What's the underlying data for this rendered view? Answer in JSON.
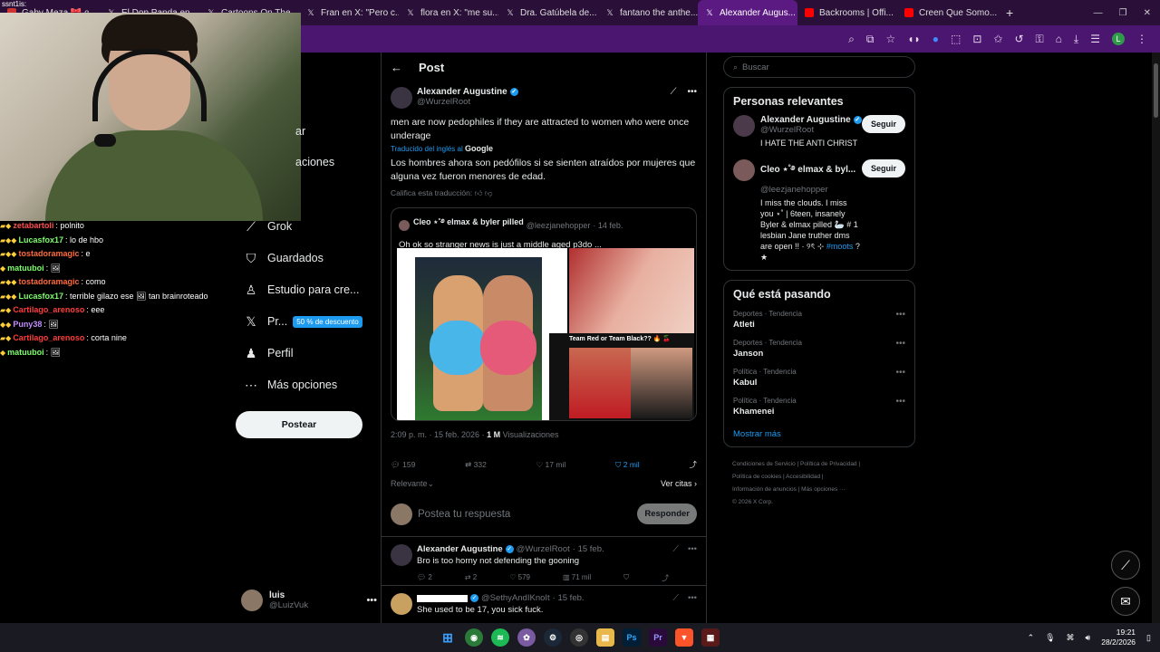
{
  "browser": {
    "tabs": [
      {
        "label": "Gaby Meza 🎀 ɞ..."
      },
      {
        "label": "El Don Panda en..."
      },
      {
        "label": "Cartoons On The..."
      },
      {
        "label": "Fran en X: \"Pero c..."
      },
      {
        "label": "flora en X: \"me su..."
      },
      {
        "label": "Dra. Gatúbela de..."
      },
      {
        "label": "fantano the anthe..."
      },
      {
        "label": "Alexander Augus..."
      },
      {
        "label": "Backrooms | Offi..."
      },
      {
        "label": "Creen Que Somo..."
      }
    ],
    "profile_letter": "L"
  },
  "overlay_text": "ssnt1is:",
  "chat": [
    {
      "user": "zetabartoli",
      "msg": "polnito",
      "color": "#ff4d4d"
    },
    {
      "user": "Lucasfox17",
      "msg": "lo de hbo",
      "color": "#7cff6b"
    },
    {
      "user": "tostadoramagic",
      "msg": "e",
      "color": "#ff6b3d"
    },
    {
      "user": "matuuboi",
      "msg": "🖼",
      "color": "#7cff6b"
    },
    {
      "user": "tostadoramagic",
      "msg": "como",
      "color": "#ff6b3d"
    },
    {
      "user": "Lucasfox17",
      "msg": "terrible gilazo ese 🖼 tan brainroteado",
      "color": "#7cff6b"
    },
    {
      "user": "Cartilago_arenoso",
      "msg": "eee",
      "color": "#ff3d3d"
    },
    {
      "user": "Puny38",
      "msg": "🖼",
      "color": "#c08cff"
    },
    {
      "user": "Cartilago_arenoso",
      "msg": "corta nine",
      "color": "#ff3d3d"
    },
    {
      "user": "matuuboi",
      "msg": "🖼",
      "color": "#7cff6b"
    }
  ],
  "nav": {
    "partial_1": "ar",
    "partial_2": "aciones",
    "items": [
      {
        "label": "Grok",
        "icon": "grok-icon",
        "glyph": "⟋"
      },
      {
        "label": "Guardados",
        "icon": "bookmark-icon",
        "glyph": "⛉"
      },
      {
        "label": "Estudio para cre...",
        "icon": "studio-icon",
        "glyph": "♙"
      },
      {
        "label": "Pr...",
        "icon": "x-logo-icon",
        "glyph": "𝕏"
      },
      {
        "label": "Perfil",
        "icon": "profile-icon",
        "glyph": "♟"
      },
      {
        "label": "Más opciones",
        "icon": "more-options-icon",
        "glyph": "⋯"
      }
    ],
    "promo": "50 % de descuento",
    "post_button": "Postear",
    "account": {
      "name": "luis",
      "handle": "@LuizVuk"
    }
  },
  "post": {
    "header": "Post",
    "author": {
      "name": "Alexander Augustine",
      "handle": "@WurzelRoot"
    },
    "text": "men are now pedophiles if they are attracted to women who were once underage",
    "translated_from": "Traducido del inglés al",
    "translator": "Google",
    "translation": "Los hombres ahora son pedófilos si se sienten atraídos por mujeres que alguna vez fueron menores de edad.",
    "rate_translation": "Califica esta traducción:",
    "quote": {
      "name": "Cleo ⋆˚࿔ elmax & byler pilled",
      "handle": "@leezjanehopper",
      "date": "· 14 feb.",
      "text": "Oh ok so stranger news is just a middle aged p3do ...",
      "image_caption": "Team Red or Team Black?? 🔥 🍒"
    },
    "timestamp": "2:09 p. m. · 15 feb. 2026 ·",
    "views_count": "1 M",
    "views_label": "Visualizaciones",
    "stats": {
      "replies": "159",
      "reposts": "332",
      "likes": "17 mil",
      "bookmarks": "2 mil"
    },
    "sort": "Relevante",
    "quotes_link": "Ver citas",
    "reply_placeholder": "Postea tu respuesta",
    "reply_button": "Responder"
  },
  "replies": [
    {
      "name": "Alexander Augustine",
      "handle": "@WurzelRoot",
      "date": "· 15 feb.",
      "text": "Bro is too horny not defending the gooning",
      "replies": "2",
      "reposts": "2",
      "likes": "579",
      "views": "71 mil"
    },
    {
      "name": "",
      "handle": "@SethyAndIKnoIt",
      "date": "· 15 feb.",
      "text": "She used to be 17, you sick fuck."
    }
  ],
  "sidebar": {
    "search_placeholder": "Buscar",
    "relevant_title": "Personas relevantes",
    "people": [
      {
        "name": "Alexander Augustine",
        "handle": "@WurzelRoot",
        "bio": "I HATE THE ANTI CHRIST",
        "link": "",
        "follow": "Seguir"
      },
      {
        "name": "Cleo ⋆˚࿔ elmax & byl...",
        "handle": "@leezjanehopper",
        "bio": "I miss the clouds. I miss you ⋆˚ | 6teen, insanely Byler & elmax pilled 🦢 # 1 lesbian Jane truther dms are open !! · ୨ৎ ⊹",
        "link": "#moots",
        "follow": "Seguir"
      }
    ],
    "trending_title": "Qué está pasando",
    "trends": [
      {
        "category": "Deportes · Tendencia",
        "title": "Atleti"
      },
      {
        "category": "Deportes · Tendencia",
        "title": "Janson"
      },
      {
        "category": "Política · Tendencia",
        "title": "Kabul"
      },
      {
        "category": "Política · Tendencia",
        "title": "Khamenei"
      }
    ],
    "show_more": "Mostrar más",
    "footer": [
      "Condiciones de Servicio",
      "Política de Privacidad",
      "Política de cookies",
      "Accesibilidad",
      "Información de anuncios",
      "Más opciones ···",
      "© 2026 X Corp."
    ]
  },
  "taskbar": {
    "time": "19:21",
    "date": "28/2/2026"
  }
}
